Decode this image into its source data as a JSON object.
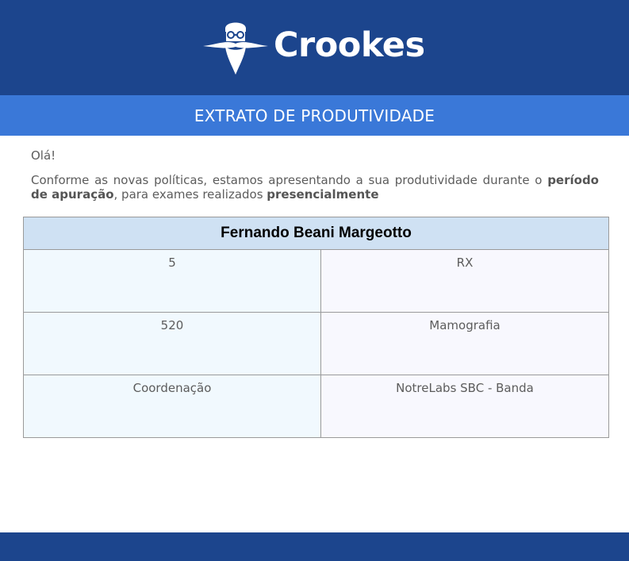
{
  "brand": {
    "name": "Crookes",
    "logo_icon": "wizard-face-icon"
  },
  "title": "EXTRATO DE PRODUTIVIDADE",
  "intro": {
    "greeting": "Olá!",
    "message_part1": "Conforme as novas políticas, estamos apresentando a sua produtividade durante o ",
    "message_bold1": "período de apuração",
    "message_part2": ", para exames realizados ",
    "message_bold2": "presencialmente"
  },
  "table": {
    "name": "Fernando Beani Margeotto",
    "rows": [
      {
        "left": "5",
        "right": "RX"
      },
      {
        "left": "520",
        "right": "Mamografia"
      },
      {
        "left": "Coordenação",
        "right": "NotreLabs SBC - Banda"
      }
    ]
  },
  "colors": {
    "header_bg": "#1c458d",
    "title_bar_bg": "#3a78d8",
    "table_header_bg": "#cfe1f3",
    "cell_left_bg": "#f1f9fe",
    "cell_right_bg": "#f8f8fe"
  }
}
